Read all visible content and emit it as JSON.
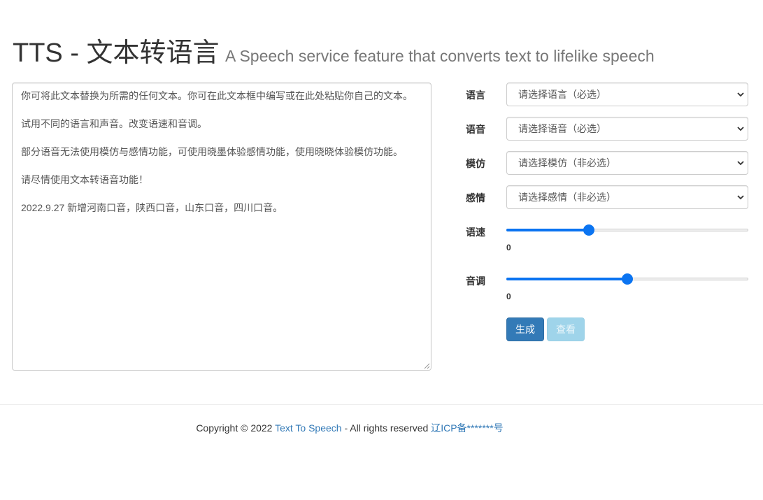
{
  "header": {
    "title": "TTS - 文本转语言",
    "subtitle": "A Speech service feature that converts text to lifelike speech"
  },
  "textarea": {
    "paragraphs": [
      "你可将此文本替换为所需的任何文本。你可在此文本框中编写或在此处粘贴你自己的文本。",
      "试用不同的语言和声音。改变语速和音调。",
      "部分语音无法使用模仿与感情功能，可使用晓墨体验感情功能，使用晓晓体验模仿功能。",
      "请尽情使用文本转语音功能！",
      "2022.9.27 新增河南口音，陕西口音，山东口音，四川口音。"
    ]
  },
  "form": {
    "language": {
      "label": "语言",
      "selected": "请选择语言（必选）"
    },
    "voice": {
      "label": "语音",
      "selected": "请选择语音（必选）"
    },
    "style": {
      "label": "模仿",
      "selected": "请选择模仿（非必选）"
    },
    "emotion": {
      "label": "感情",
      "selected": "请选择感情（非必选）"
    },
    "rate": {
      "label": "语速",
      "value": "0",
      "position_fraction": 0.34
    },
    "pitch": {
      "label": "音调",
      "value": "0",
      "position_fraction": 0.5
    }
  },
  "buttons": {
    "generate": "生成",
    "view": "查看"
  },
  "footer": {
    "copyright": "Copyright © 2022 ",
    "site_link": "Text To Speech",
    "rights": " - All rights reserved ",
    "icp_link": "辽ICP备*******号"
  },
  "colors": {
    "primary": "#337ab7",
    "slider": "#0b74f1",
    "disabled_button": "#9fd4ea"
  }
}
